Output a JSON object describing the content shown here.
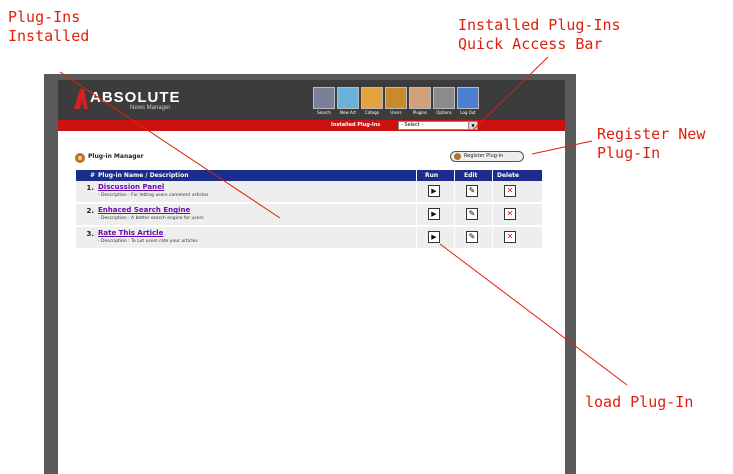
{
  "annotations": {
    "installed": "Plug-Ins\nInstalled",
    "quick_access": "Installed Plug-Ins\nQuick Access Bar",
    "register": "Register New\nPlug-In",
    "load": "load Plug-In"
  },
  "app": {
    "logo": "ABSOLUTE",
    "logo_sub": "News Manager"
  },
  "nav": [
    {
      "label": "Search",
      "icon": "search-icon",
      "color": "#7a7f9a"
    },
    {
      "label": "New Art",
      "icon": "new-article-icon",
      "color": "#6ab0d8"
    },
    {
      "label": "Catego",
      "icon": "categories-icon",
      "color": "#e6a23c"
    },
    {
      "label": "Users",
      "icon": "users-icon",
      "color": "#c88a2a"
    },
    {
      "label": "Plugins",
      "icon": "plugins-icon",
      "color": "#d2a07a"
    },
    {
      "label": "Options",
      "icon": "options-icon",
      "color": "#8c8c8c"
    },
    {
      "label": "Log Out",
      "icon": "logout-icon",
      "color": "#4d7fd0"
    }
  ],
  "redbar": {
    "label": "Installed Plug-Ins",
    "select_value": "- Select -"
  },
  "plugin_manager": {
    "title": "Plug-in Manager",
    "register_button": "Register Plug-In"
  },
  "table": {
    "headers": {
      "num": "#",
      "name": "Plug-in Name / Description",
      "run": "Run",
      "edit": "Edit",
      "delete": "Delete"
    },
    "rows": [
      {
        "num": "1.",
        "name": "Discussion Panel",
        "desc": "- Description : For letting users comment articles"
      },
      {
        "num": "2.",
        "name": "Enhaced Search Engine",
        "desc": "- Description : A better search engine for users"
      },
      {
        "num": "3.",
        "name": "Rate This Article",
        "desc": "- Description : To Let users rate your articles"
      }
    ]
  },
  "colors": {
    "annotation": "#e0200b",
    "header_bar": "#1a2d8a",
    "red_bar": "#cc1111",
    "link": "#6a0dad"
  }
}
